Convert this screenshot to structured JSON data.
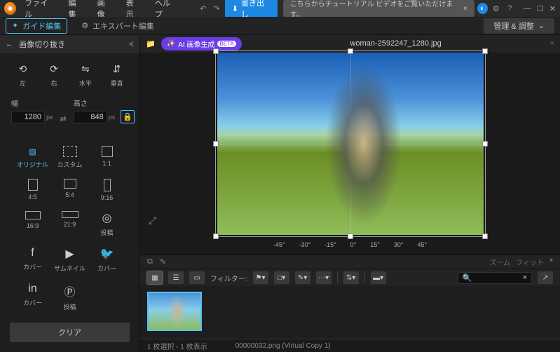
{
  "menu": {
    "file": "ファイル",
    "edit": "編集",
    "image": "画像",
    "view": "表示",
    "help": "ヘルプ"
  },
  "top": {
    "export": "書き出し",
    "tutorial": "こちらからチュートリアル ビデオをご覧いただけます。"
  },
  "modes": {
    "guide": "ガイド編集",
    "expert": "エキスパート編集",
    "manage": "管理 & 調整"
  },
  "side": {
    "title": "画像切り抜き",
    "flip": {
      "left": "左",
      "right": "右",
      "horizontal": "水平",
      "vertical": "垂直"
    },
    "w_label": "幅",
    "h_label": "高さ",
    "w": "1280",
    "h": "848",
    "unit": "px",
    "presets": {
      "original": "オリジナル",
      "custom": "カスタム",
      "p11": "1:1",
      "p45": "4:5",
      "p54": "5:4",
      "p916": "9:16",
      "p169": "16:9",
      "p219": "21:9",
      "post": "投稿",
      "cover": "カバー",
      "thumbnail": "サムネイル"
    },
    "clear": "クリア"
  },
  "file": {
    "ai": "AI 画像生成",
    "beta": "BETA",
    "name": "woman-2592247_1280.jpg"
  },
  "ruler": {
    "m45": "-45°",
    "m30": "-30°",
    "m15": "-15°",
    "z": "0°",
    "p15": "15°",
    "p30": "30°",
    "p45": "45°"
  },
  "tb": {
    "zoom": "ズーム",
    "fit": "フィット"
  },
  "filter": {
    "label": "フィルター:"
  },
  "status": {
    "sel": "1 枚選択 - 1 枚表示",
    "file": "00000032.png (Virtual Copy 1)"
  }
}
